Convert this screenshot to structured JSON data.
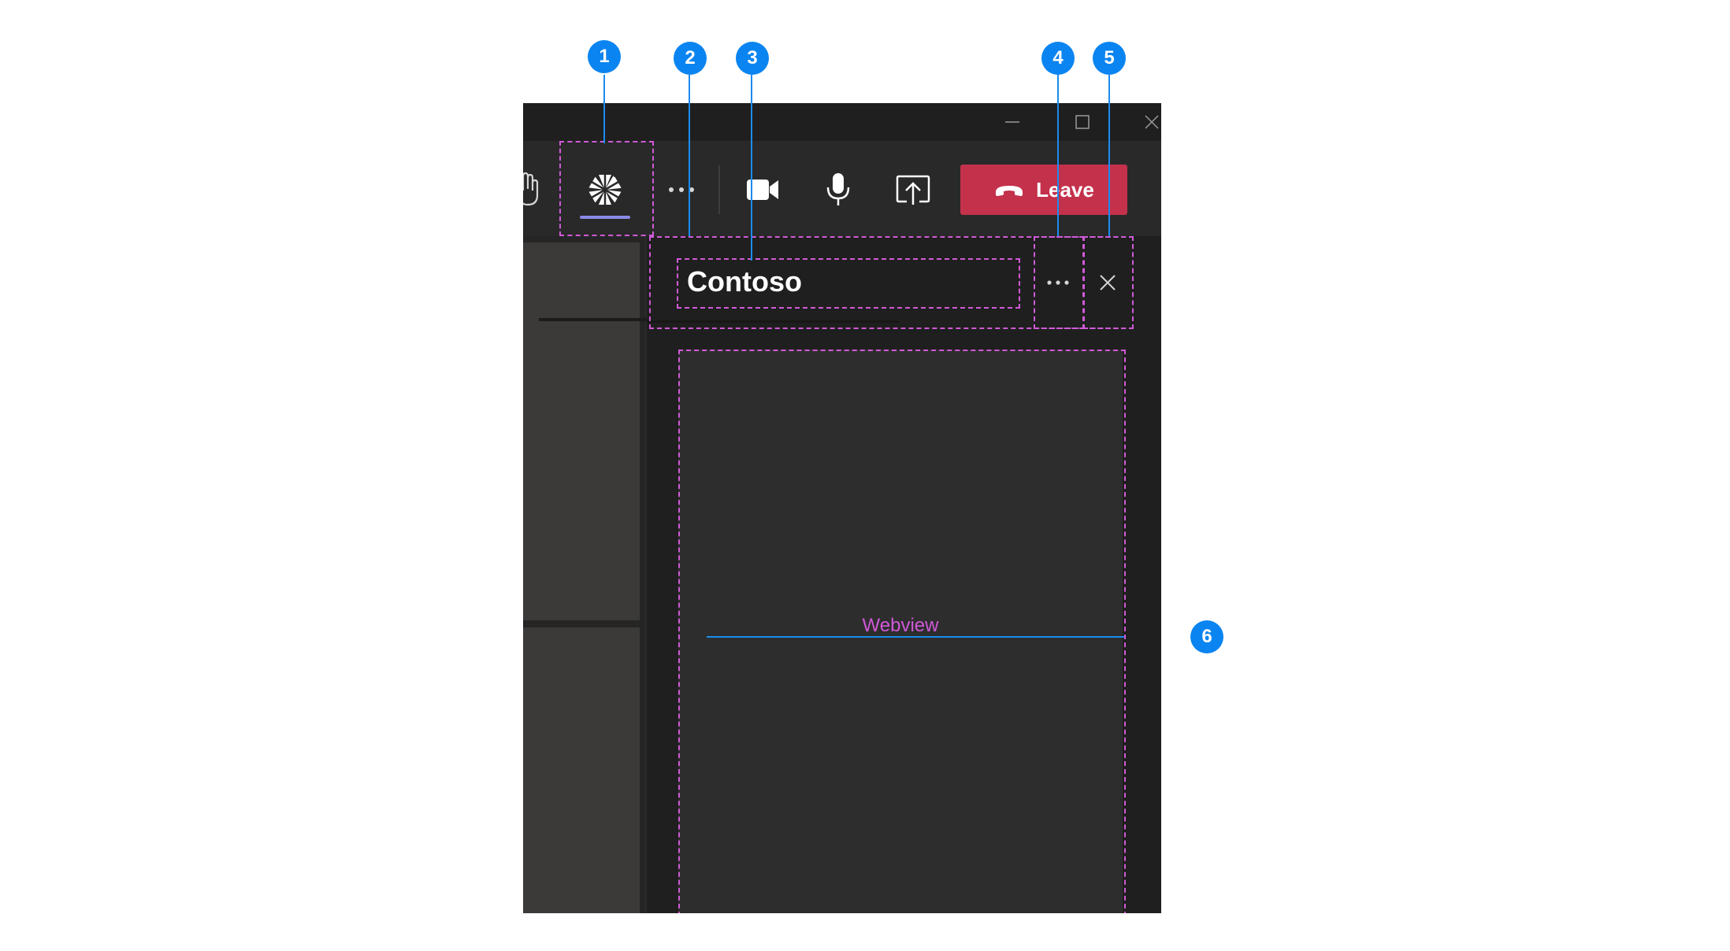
{
  "window": {
    "controls": {
      "minimize_icon": "minimize-icon",
      "maximize_icon": "maximize-icon",
      "close_icon": "close-icon"
    }
  },
  "toolbar": {
    "items": [
      {
        "name": "raise-hand",
        "icon": "hand-icon"
      },
      {
        "name": "app",
        "icon": "app-icon"
      },
      {
        "name": "more",
        "icon": "more-icon"
      },
      {
        "name": "camera",
        "icon": "camera-icon"
      },
      {
        "name": "microphone",
        "icon": "microphone-icon"
      },
      {
        "name": "share",
        "icon": "share-icon"
      }
    ],
    "leave_label": "Leave",
    "leave_color": "#c4314b",
    "accent": "#8b8ae6"
  },
  "panel": {
    "title": "Contoso",
    "more_icon": "more-icon",
    "close_icon": "close-icon",
    "webview_label": "Webview"
  },
  "callouts": [
    "1",
    "2",
    "3",
    "4",
    "5",
    "6"
  ]
}
